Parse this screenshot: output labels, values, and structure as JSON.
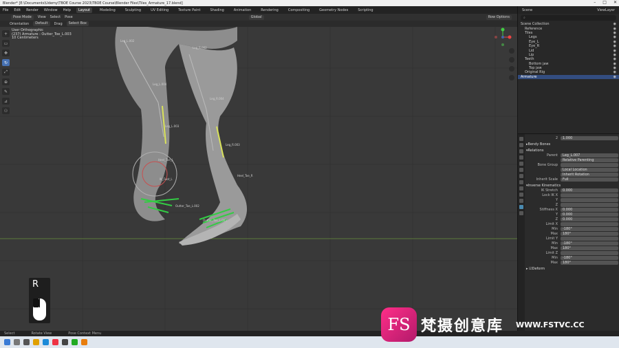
{
  "window": {
    "title": "Blender* [E:\\Documents\\Udemy\\TBOE Course 2023\\TBOE Course\\Blender Files\\Tiles_Armature_17.blend]",
    "controls": [
      "–",
      "□",
      "✕"
    ]
  },
  "menubar": {
    "menus": [
      "File",
      "Edit",
      "Render",
      "Window",
      "Help"
    ],
    "workspaces": [
      "Layout",
      "Modeling",
      "Sculpting",
      "UV Editing",
      "Texture Paint",
      "Shading",
      "Animation",
      "Rendering",
      "Compositing",
      "Geometry Nodes",
      "Scripting"
    ],
    "active_workspace": "Layout",
    "scene": "Scene",
    "view_layer": "ViewLayer"
  },
  "viewport_header": {
    "mode": "Pose Mode",
    "menus": [
      "View",
      "Select",
      "Pose"
    ],
    "orientation": "Global",
    "options": "Row Options"
  },
  "tool_header": {
    "orientation_label": "Orientation",
    "orientation_value": "Default",
    "drag_label": "Drag",
    "drag_value": "Select Box"
  },
  "viewport_info": {
    "line1": "User Orthographic",
    "line2": "(237) Armature : Outter_Toe_L.003",
    "line3": "10 Centimeters"
  },
  "toolbar": {
    "icons": [
      "cursor-icon",
      "select-icon",
      "move-icon",
      "rotate-icon",
      "scale-icon",
      "transform-icon",
      "annotate-icon",
      "measure-icon",
      "pose-tool-icon"
    ],
    "active_index": 3
  },
  "bone_labels": [
    "Leg_L.002",
    "Leg_L.003",
    "Leg_L.004",
    "Leg_R.002",
    "Leg_R.003",
    "Leg_R.004",
    "Heel_Toe_L",
    "IK_Foot_L",
    "Heel_Toe_R",
    "Outter_Toe_L.002",
    "Outter_Toe_L.003"
  ],
  "keycast": {
    "key": "R"
  },
  "outliner": {
    "search_placeholder": "",
    "rows": [
      {
        "label": "Scene Collection",
        "indent": 0,
        "selected": false
      },
      {
        "label": "Reference",
        "indent": 1,
        "selected": false
      },
      {
        "label": "Tiles",
        "indent": 1,
        "selected": false
      },
      {
        "label": "Legs",
        "indent": 2,
        "selected": false
      },
      {
        "label": "Eye_L",
        "indent": 2,
        "selected": false
      },
      {
        "label": "Eye_R",
        "indent": 2,
        "selected": false
      },
      {
        "label": "Lid",
        "indent": 2,
        "selected": false
      },
      {
        "label": "Lip",
        "indent": 2,
        "selected": false
      },
      {
        "label": "Teeth",
        "indent": 1,
        "selected": false
      },
      {
        "label": "Bottom jaw",
        "indent": 2,
        "selected": false
      },
      {
        "label": "Top jaw",
        "indent": 2,
        "selected": false
      },
      {
        "label": "Original Rig",
        "indent": 1,
        "selected": false
      },
      {
        "label": "Armature",
        "indent": 0,
        "selected": true
      }
    ]
  },
  "properties": {
    "top_value": "2",
    "top_field": "1.000",
    "sections": {
      "bendy_bones": "Bendy Bones",
      "relations": "Relations",
      "inverse_kinematics": "Inverse Kinematics",
      "deform": "Deform"
    },
    "fields": [
      {
        "k": "Parent",
        "v": "Leg_L.007"
      },
      {
        "k": "",
        "v": "Relative Parenting"
      },
      {
        "k": "Bone Group",
        "v": ""
      },
      {
        "k": "",
        "v": "Local Location"
      },
      {
        "k": "",
        "v": "Inherit Rotation"
      },
      {
        "k": "Inherit Scale",
        "v": "Full"
      }
    ],
    "ik_fields": [
      {
        "k": "IK Stretch",
        "v": "0.000"
      },
      {
        "k": "Lock IK X",
        "v": ""
      },
      {
        "k": "Y",
        "v": ""
      },
      {
        "k": "Z",
        "v": ""
      },
      {
        "k": "Stiffness X",
        "v": "0.000"
      },
      {
        "k": "Y",
        "v": "0.000"
      },
      {
        "k": "Z",
        "v": "0.000"
      },
      {
        "k": "Limit X",
        "v": ""
      },
      {
        "k": "Min",
        "v": "-180°"
      },
      {
        "k": "Max",
        "v": "180°"
      },
      {
        "k": "Limit Y",
        "v": ""
      },
      {
        "k": "Min",
        "v": "-180°"
      },
      {
        "k": "Max",
        "v": "180°"
      },
      {
        "k": "Limit Z",
        "v": ""
      },
      {
        "k": "Min",
        "v": "-180°"
      },
      {
        "k": "Max",
        "v": "180°"
      }
    ]
  },
  "statusbar": {
    "items": [
      "Select",
      "Rotate View",
      "Pose Context Menu"
    ]
  },
  "watermark": {
    "logo": "FS",
    "text_cn": "梵摄创意库",
    "url": "WWW.FSTVC.CC"
  },
  "colors": {
    "viewport_bg": "#393939",
    "selected_blue": "#4772b3",
    "bone_green": "#33cc44",
    "watermark_pink": "#ff2e88"
  }
}
